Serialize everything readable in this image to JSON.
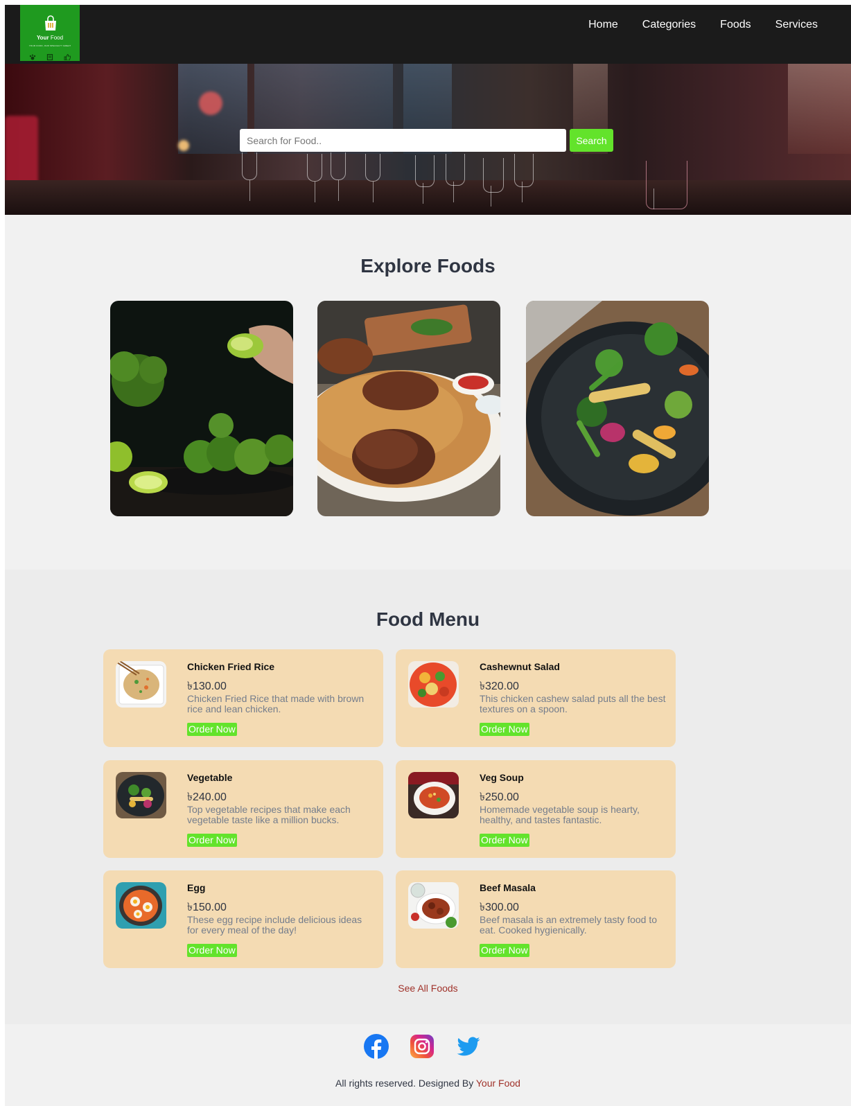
{
  "logo": {
    "name_bold": "Your",
    "name_rest": "Food",
    "tagline": "YOUR FOOD, OUR SPECIALTY GREAT",
    "bag_icon": "shopping-bag-icon",
    "badge_icons": [
      "paw-icon",
      "menu-card-icon",
      "thumbs-up-icon"
    ],
    "background": "#1f9a1f"
  },
  "nav": {
    "items": [
      {
        "label": "Home"
      },
      {
        "label": "Categories"
      },
      {
        "label": "Foods"
      },
      {
        "label": "Services"
      }
    ]
  },
  "search": {
    "placeholder": "Search for Food..",
    "button_label": "Search"
  },
  "explore": {
    "title": "Explore Foods",
    "tiles": [
      "broccoli-lime-photo",
      "chicken-biryani-photo",
      "vegetable-stir-fry-photo"
    ]
  },
  "menu": {
    "title": "Food Menu",
    "items": [
      {
        "name": "Chicken Fried Rice",
        "price": "৳130.00",
        "description": "Chicken Fried Rice that made with brown rice and lean chicken.",
        "button": "Order Now"
      },
      {
        "name": "Cashewnut Salad",
        "price": "৳320.00",
        "description": "This chicken cashew salad puts all the best textures on a spoon.",
        "button": "Order Now"
      },
      {
        "name": "Vegetable",
        "price": "৳240.00",
        "description": "Top vegetable recipes that make each vegetable taste like a million bucks.",
        "button": "Order Now"
      },
      {
        "name": "Veg Soup",
        "price": "৳250.00",
        "description": "Homemade vegetable soup is hearty, healthy, and tastes fantastic.",
        "button": "Order Now"
      },
      {
        "name": "Egg",
        "price": "৳150.00",
        "description": "These egg recipe include delicious ideas for every meal of the day!",
        "button": "Order Now"
      },
      {
        "name": "Beef Masala",
        "price": "৳300.00",
        "description": "Beef masala is an extremely tasty food to eat. Cooked hygienically.",
        "button": "Order Now"
      }
    ],
    "see_all": "See All Foods"
  },
  "footer": {
    "social": [
      "facebook-icon",
      "instagram-icon",
      "twitter-icon"
    ],
    "copyright_prefix": "All rights reserved. Designed By",
    "brand": "Your Food"
  },
  "colors": {
    "nav_bg": "#1b1b1b",
    "accent_green": "#63e32b",
    "card_bg": "#f4dbb3",
    "link_red": "#a0322a",
    "heading": "#2f3542"
  }
}
